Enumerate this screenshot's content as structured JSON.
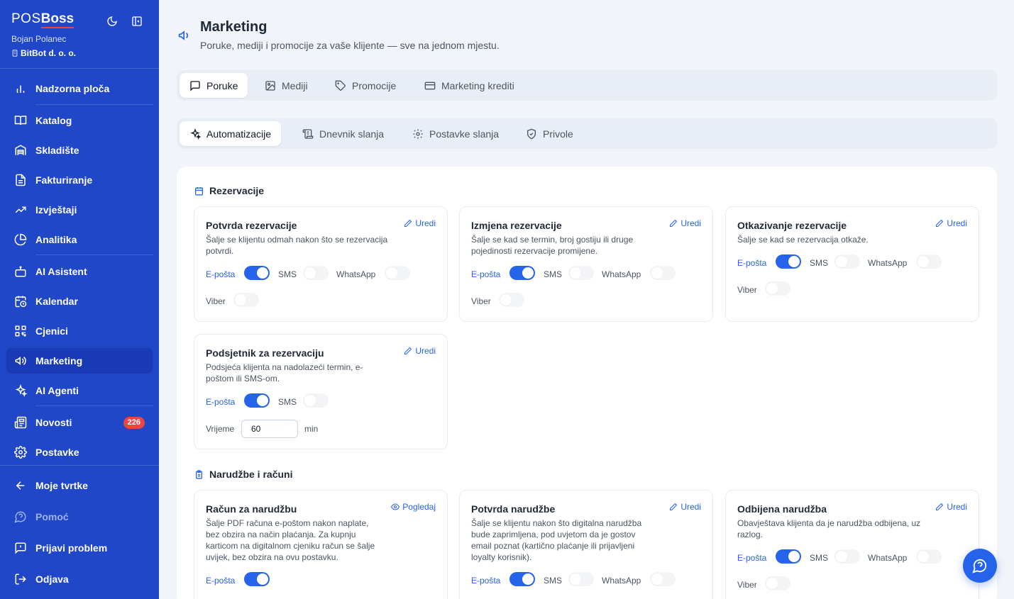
{
  "brand": {
    "pos": "POS",
    "boss": "Boss"
  },
  "user": {
    "name": "Bojan Polanec",
    "company": "BitBot d. o. o."
  },
  "nav": [
    {
      "label": "Nadzorna ploča",
      "icon": "bar-chart-icon"
    },
    {
      "label": "Katalog",
      "icon": "book-icon"
    },
    {
      "label": "Skladište",
      "icon": "warehouse-icon"
    },
    {
      "label": "Fakturiranje",
      "icon": "file-text-icon"
    },
    {
      "label": "Izvještaji",
      "icon": "trending-up-icon"
    },
    {
      "label": "Analitika",
      "icon": "pie-chart-icon"
    },
    {
      "label": "AI Asistent",
      "icon": "bot-icon"
    },
    {
      "label": "Kalendar",
      "icon": "calendar-clock-icon"
    },
    {
      "label": "Cjenici",
      "icon": "qr-code-icon"
    },
    {
      "label": "Marketing",
      "icon": "megaphone-icon"
    },
    {
      "label": "AI Agenti",
      "icon": "sparkles-icon"
    },
    {
      "label": "Novosti",
      "icon": "newspaper-icon",
      "badge": "226"
    },
    {
      "label": "Postavke",
      "icon": "gear-icon"
    },
    {
      "label": "Moje tvrtke",
      "icon": "arrow-left-icon"
    },
    {
      "label": "Pomoć",
      "icon": "help-circle-icon"
    },
    {
      "label": "Prijavi problem",
      "icon": "message-alert-icon"
    },
    {
      "label": "Odjava",
      "icon": "logout-icon"
    }
  ],
  "page": {
    "title": "Marketing",
    "subtitle": "Poruke, mediji i promocije za vaše klijente — sve na jednom mjestu."
  },
  "tabs": [
    "Poruke",
    "Mediji",
    "Promocije",
    "Marketing krediti"
  ],
  "subtabs": [
    "Automatizacije",
    "Dnevnik slanja",
    "Postavke slanja",
    "Privole"
  ],
  "sections": {
    "reservations": "Rezervacije",
    "orders": "Narudžbe i računi"
  },
  "channels": {
    "email": "E-pošta",
    "sms": "SMS",
    "whatsapp": "WhatsApp",
    "viber": "Viber"
  },
  "actions": {
    "edit": "Uredi",
    "view": "Pogledaj"
  },
  "time": {
    "label": "Vrijeme",
    "value": "60",
    "unit": "min"
  },
  "cards": {
    "c1": {
      "title": "Potvrda rezervacije",
      "desc": "Šalje se klijentu odmah nakon što se rezervacija potvrdi."
    },
    "c2": {
      "title": "Izmjena rezervacije",
      "desc": "Šalje se kad se termin, broj gostiju ili druge pojedinosti rezervacije promijene."
    },
    "c3": {
      "title": "Otkazivanje rezervacije",
      "desc": "Šalje se kad se rezervacija otkaže."
    },
    "c4": {
      "title": "Podsjetnik za rezervaciju",
      "desc": "Podsjeća klijenta na nadolazeći termin, e-poštom ili SMS-om."
    },
    "c5": {
      "title": "Račun za narudžbu",
      "desc": "Šalje PDF računa e-poštom nakon naplate, bez obzira na način plaćanja. Za kupnju karticom na digitalnom cjeniku račun se šalje uvijek, bez obzira na ovu postavku."
    },
    "c6": {
      "title": "Potvrda narudžbe",
      "desc": "Šalje se klijentu nakon što digitalna narudžba bude zaprimljena, pod uvjetom da je gostov email poznat (kartično plaćanje ili prijavljeni loyalty korisnik)."
    },
    "c7": {
      "title": "Odbijena narudžba",
      "desc": "Obavještava klijenta da je narudžba odbijena, uz razlog."
    }
  },
  "colors": {
    "sidebar": "#2147c9",
    "accent": "#2563eb",
    "badge": "#ef4444"
  }
}
